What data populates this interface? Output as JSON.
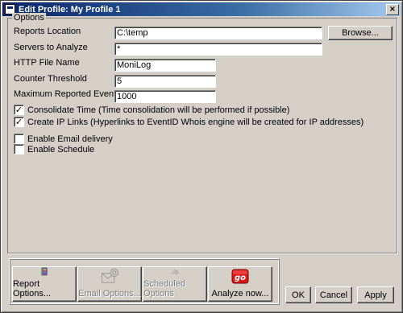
{
  "window": {
    "title": "Edit Profile: My Profile 1",
    "close_label": "×"
  },
  "options": {
    "group_label": "Options",
    "reports_location": {
      "label": "Reports Location",
      "value": "C:\\temp",
      "browse_label": "Browse..."
    },
    "servers_to_analyze": {
      "label": "Servers to Analyze",
      "value": "*"
    },
    "http_file_name": {
      "label": "HTTP File Name",
      "value": "MoniLog"
    },
    "counter_threshold": {
      "label": "Counter Threshold",
      "value": "5"
    },
    "max_reported_events": {
      "label": "Maximum Reported Events",
      "value": "1000"
    },
    "checkboxes": [
      {
        "label": "Consolidate Time (Time consolidation will be performed if possible)",
        "checked": true
      },
      {
        "label": "Create IP Links (Hyperlinks to EventID Whois engine will be created for IP addresses)",
        "checked": true
      },
      {
        "label": "Enable Email delivery",
        "checked": false
      },
      {
        "label": "Enable Schedule",
        "checked": false
      }
    ]
  },
  "toolbar": {
    "report_options": {
      "label": "Report Options...",
      "icon": "report-book-icon",
      "enabled": true
    },
    "email_options": {
      "label": "Email Options...",
      "icon": "email-gear-icon",
      "enabled": false
    },
    "scheduled_options": {
      "label": "Scheduled Options",
      "icon": "schedule-gear-icon",
      "enabled": false
    },
    "analyze_now": {
      "label": "Analyze now...",
      "icon": "go-icon",
      "icon_text": "go",
      "enabled": true
    }
  },
  "dialog_buttons": {
    "ok": "OK",
    "cancel": "Cancel",
    "apply": "Apply"
  }
}
